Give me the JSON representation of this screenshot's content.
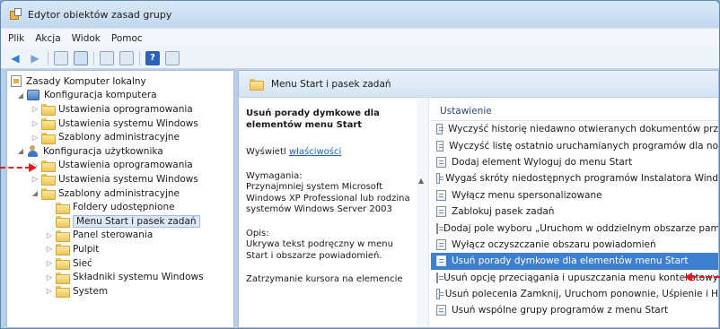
{
  "window": {
    "title": "Edytor obiektów zasad grupy"
  },
  "menubar": {
    "items": [
      "Plik",
      "Akcja",
      "Widok",
      "Pomoc"
    ]
  },
  "toolbar": {
    "icons": [
      "back-arrow-icon",
      "forward-arrow-icon",
      "up-folder-icon",
      "show-tree-icon",
      "properties-icon",
      "export-icon",
      "help-icon",
      "view-icon"
    ]
  },
  "tree": {
    "items": [
      {
        "label": "Zasady Komputer lokalny"
      },
      {
        "label": "Konfiguracja komputera"
      },
      {
        "label": "Ustawienia oprogramowania"
      },
      {
        "label": "Ustawienia systemu Windows"
      },
      {
        "label": "Szablony administracyjne"
      },
      {
        "label": "Konfiguracja użytkownika"
      },
      {
        "label": "Ustawienia oprogramowania"
      },
      {
        "label": "Ustawienia systemu Windows"
      },
      {
        "label": "Szablony administracyjne"
      },
      {
        "label": "Foldery udostępnione"
      },
      {
        "label": "Menu Start i pasek zadań"
      },
      {
        "label": "Panel sterowania"
      },
      {
        "label": "Pulpit"
      },
      {
        "label": "Sieć"
      },
      {
        "label": "Składniki systemu Windows"
      },
      {
        "label": "System"
      }
    ]
  },
  "panel": {
    "header": "Menu Start i pasek zadań",
    "description": {
      "heading": "Usuń porady dymkowe dla elementów menu Start",
      "show_prefix": "Wyświetl",
      "show_link": "właściwości",
      "requirements_label": "Wymagania:",
      "requirements_text": "Przynajmniej system Microsoft Windows XP Professional lub rodzina systemów Windows Server 2003",
      "description_label": "Opis:",
      "description_text": "Ukrywa tekst podręczny w menu Start i obszarze powiadomień.",
      "more_text": "Zatrzymanie kursora na elemencie"
    },
    "list": {
      "column_header": "Ustawienie",
      "rows": [
        "Wyczyść historię niedawno otwieranych dokumentów prz",
        "Wyczyść listę ostatnio uruchamianych programów dla no",
        "Dodaj element Wyloguj do menu Start",
        "Wygaś skróty niedostępnych programów Instalatora Wind",
        "Wyłącz menu spersonalizowane",
        "Zablokuj pasek zadań",
        "Dodaj pole wyboru „Uruchom w oddzielnym obszarze pam",
        "Wyłącz oczyszczanie obszaru powiadomień",
        "Usuń porady dymkowe dla elementów menu Start",
        "Usuń opcję przeciągania i upuszczania menu kontekstowy",
        "Usuń polecenia Zamknij, Uruchom ponownie, Uśpienie i H",
        "Usuń wspólne grupy programów z menu Start"
      ]
    }
  },
  "colors": {
    "annotation": "#e31b1b",
    "selection": "#3f7fd0"
  }
}
